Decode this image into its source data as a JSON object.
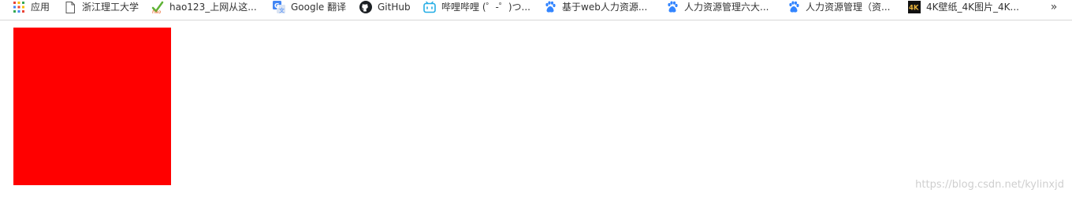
{
  "bookmarks": {
    "items": [
      {
        "label": "应用",
        "icon": "apps-grid-icon"
      },
      {
        "label": "浙江理工大学",
        "icon": "page-icon"
      },
      {
        "label": "hao123_上网从这...",
        "icon": "hao123-icon"
      },
      {
        "label": "Google 翻译",
        "icon": "google-translate-icon"
      },
      {
        "label": "GitHub",
        "icon": "github-icon"
      },
      {
        "label": "哔哩哔哩 (゜-゜)つ...",
        "icon": "bilibili-icon"
      },
      {
        "label": "基于web人力资源...",
        "icon": "baidu-paw-icon"
      },
      {
        "label": "人力资源管理六大...",
        "icon": "baidu-paw-icon"
      },
      {
        "label": "人力资源管理（资...",
        "icon": "baidu-paw-icon"
      },
      {
        "label": "4K壁纸_4K图片_4K...",
        "icon": "4k-icon"
      }
    ],
    "overflow": "»"
  },
  "content": {
    "box_color": "#ff0000"
  },
  "watermark": "https://blog.csdn.net/kylinxjd"
}
